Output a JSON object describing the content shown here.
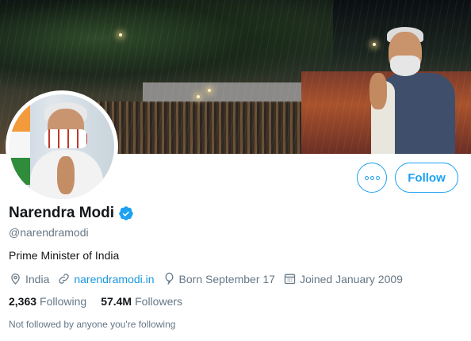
{
  "profile": {
    "name": "Narendra Modi",
    "handle": "@narendramodi",
    "bio": "Prime Minister of India",
    "verified": true,
    "location": "India",
    "website": "narendramodi.in",
    "birthday": "Born September 17",
    "joined": "Joined January 2009"
  },
  "actions": {
    "more_icon": "more-horizontal-icon",
    "follow_label": "Follow"
  },
  "stats": {
    "following_count": "2,363",
    "following_label": "Following",
    "followers_count": "57.4M",
    "followers_label": "Followers"
  },
  "followed_note": "Not followed by anyone you're following",
  "colors": {
    "accent": "#1da1f2",
    "link": "#1b95e0",
    "muted_text": "#657786",
    "primary_text": "#14171a"
  }
}
